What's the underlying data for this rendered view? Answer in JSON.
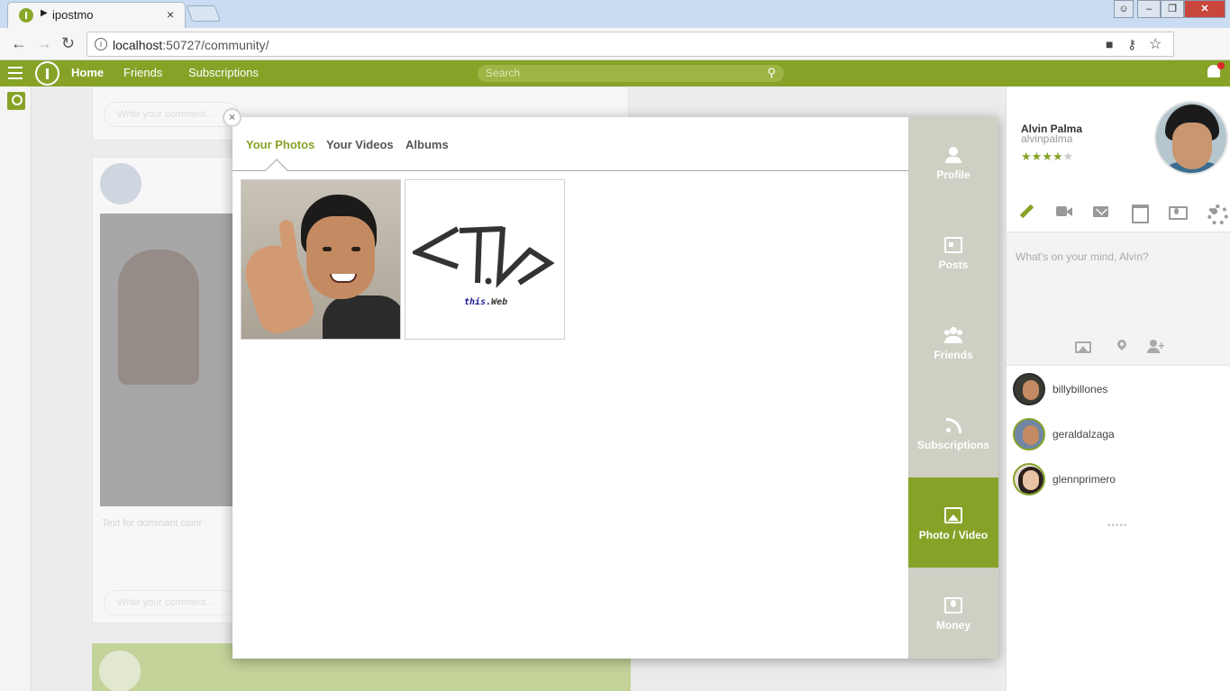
{
  "browser": {
    "tab_title": "ipostmo",
    "tab_playing_glyph": "▶",
    "tab_close": "×",
    "url_host": "localhost",
    "url_rest": ":50727/community/"
  },
  "appbar": {
    "nav": [
      "Home",
      "Friends",
      "Subscriptions"
    ],
    "search_placeholder": "Search"
  },
  "feed": {
    "comment_placeholder": "Write your comment...",
    "caption": "Text for dominant color"
  },
  "modal": {
    "close_glyph": "×",
    "tabs": [
      {
        "label": "Your Photos",
        "active": true
      },
      {
        "label": "Your Videos",
        "active": false
      },
      {
        "label": "Albums",
        "active": false
      }
    ],
    "thumb2_text_part1": "this.",
    "thumb2_text_part2": "Web",
    "side_menu": [
      {
        "label": "Profile",
        "icon": "user-icon",
        "active": false
      },
      {
        "label": "Posts",
        "icon": "id-card-icon",
        "active": false
      },
      {
        "label": "Friends",
        "icon": "users-icon",
        "active": false
      },
      {
        "label": "Subscriptions",
        "icon": "rss-icon",
        "active": false
      },
      {
        "label": "Photo / Video",
        "icon": "image-icon",
        "active": true
      },
      {
        "label": "Money",
        "icon": "money-icon",
        "active": false
      }
    ]
  },
  "profile": {
    "name": "Alvin Palma",
    "username": "alvinpalma",
    "rating": 4,
    "rating_max": 5,
    "compose_placeholder": "What's on your mind, Alvin?"
  },
  "friends": [
    {
      "name": "billybillones"
    },
    {
      "name": "geraldalzaga"
    },
    {
      "name": "glennprimero"
    }
  ],
  "more_indicator": "•••••",
  "colors": {
    "accent": "#86a328",
    "side_menu_bg": "#cfcfc4"
  }
}
